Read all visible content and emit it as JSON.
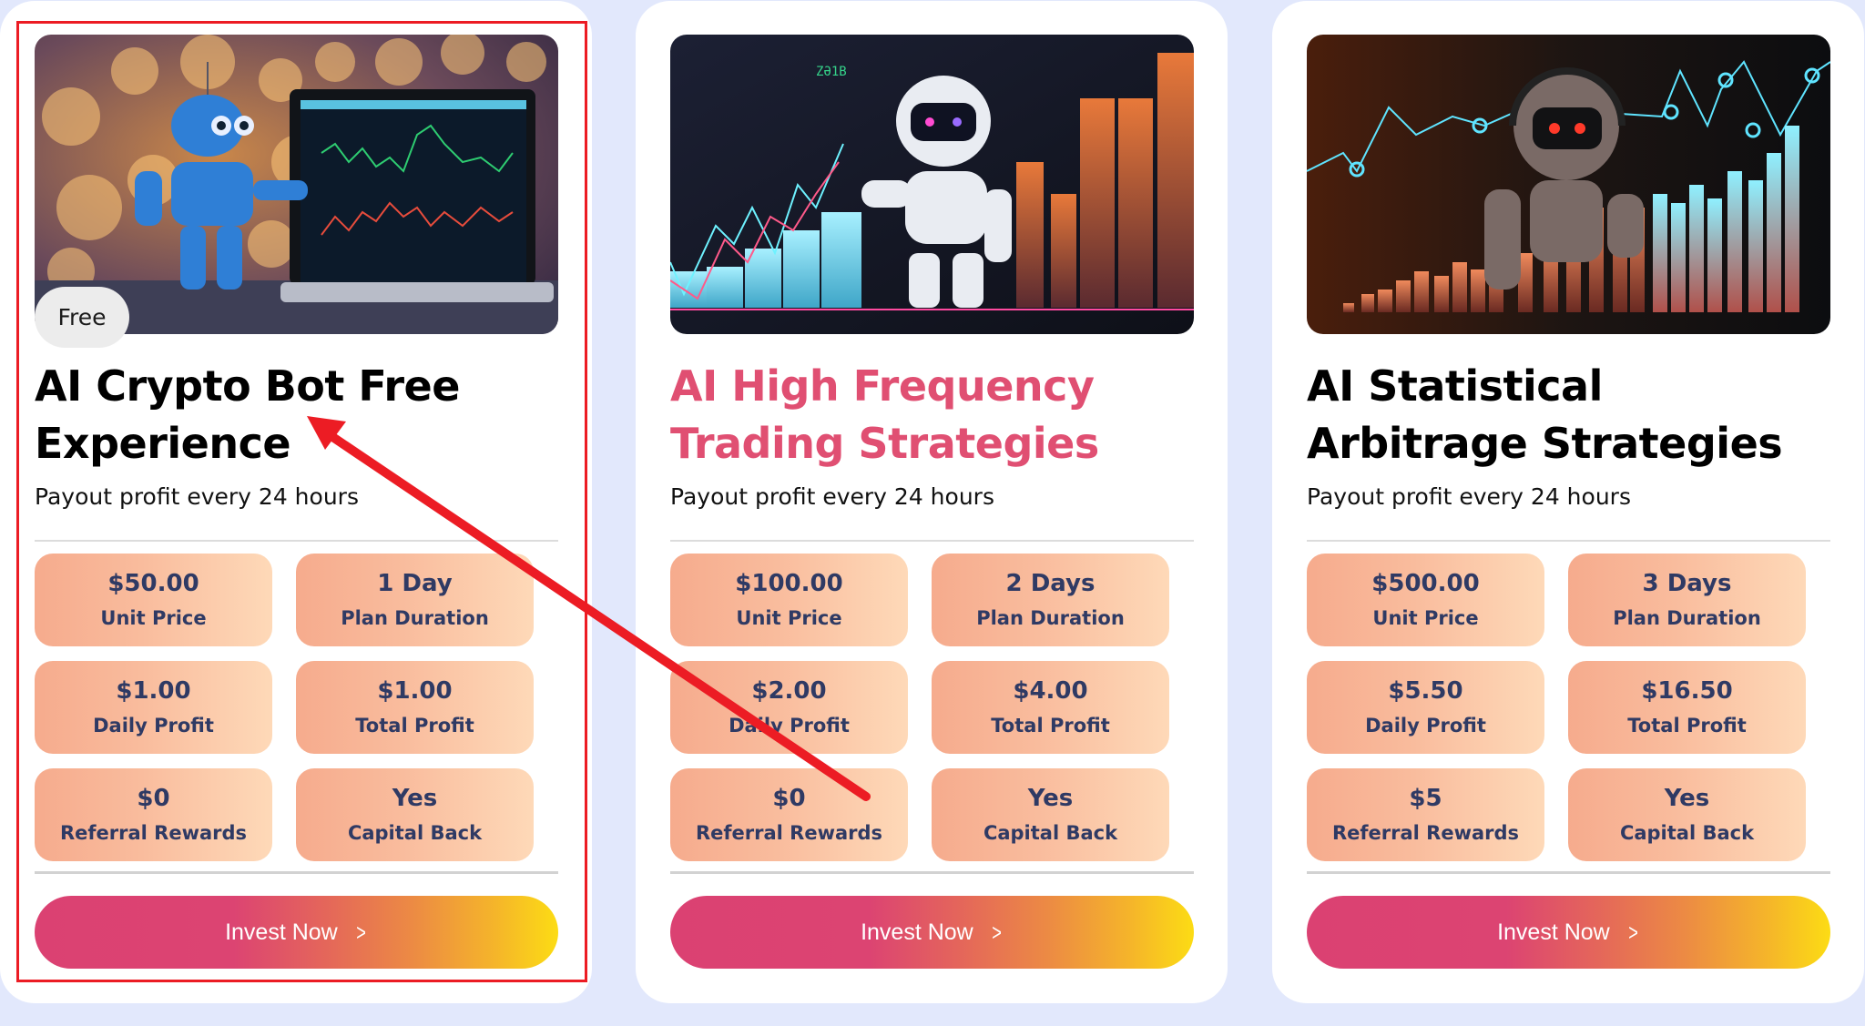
{
  "colors": {
    "page_background": "#e2e8fc",
    "card_background": "#ffffff",
    "highlight_title": "#e04f72",
    "stat_text": "#2f3a64",
    "stat_gradient": [
      "#f6ab8d",
      "#fed9b8"
    ],
    "button_gradient": [
      "#db4172",
      "#ec8a44",
      "#fcdc14"
    ],
    "annotation": "#ec1c24"
  },
  "plans": [
    {
      "image": "robot-with-laptop-trading-chart",
      "badge": "Free",
      "title": "AI Crypto Bot Free Experience",
      "title_highlighted": false,
      "subtitle": "Payout profit every 24 hours",
      "stats": [
        {
          "value": "$50.00",
          "label": "Unit Price"
        },
        {
          "value": "1 Day",
          "label": "Plan Duration"
        },
        {
          "value": "$1.00",
          "label": "Daily Profit"
        },
        {
          "value": "$1.00",
          "label": "Total Profit"
        },
        {
          "value": "$0",
          "label": "Referral Rewards"
        },
        {
          "value": "Yes",
          "label": "Capital Back"
        }
      ],
      "button": {
        "label": "Invest Now",
        "icon": "chevron-right-icon"
      }
    },
    {
      "image": "white-robot-with-bar-chart",
      "badge": null,
      "title": "AI High Frequency Trading Strategies",
      "title_highlighted": true,
      "subtitle": "Payout profit every 24 hours",
      "stats": [
        {
          "value": "$100.00",
          "label": "Unit Price"
        },
        {
          "value": "2 Days",
          "label": "Plan Duration"
        },
        {
          "value": "$2.00",
          "label": "Daily Profit"
        },
        {
          "value": "$4.00",
          "label": "Total Profit"
        },
        {
          "value": "$0",
          "label": "Referral Rewards"
        },
        {
          "value": "Yes",
          "label": "Capital Back"
        }
      ],
      "button": {
        "label": "Invest Now",
        "icon": "chevron-right-icon"
      }
    },
    {
      "image": "metal-robot-with-headphones-bar-chart",
      "badge": null,
      "title": "AI Statistical Arbitrage Strategies",
      "title_highlighted": false,
      "subtitle": "Payout profit every 24 hours",
      "stats": [
        {
          "value": "$500.00",
          "label": "Unit Price"
        },
        {
          "value": "3 Days",
          "label": "Plan Duration"
        },
        {
          "value": "$5.50",
          "label": "Daily Profit"
        },
        {
          "value": "$16.50",
          "label": "Total Profit"
        },
        {
          "value": "$5",
          "label": "Referral Rewards"
        },
        {
          "value": "Yes",
          "label": "Capital Back"
        }
      ],
      "button": {
        "label": "Invest Now",
        "icon": "chevron-right-icon"
      }
    }
  ],
  "annotation": {
    "highlight": "red-rectangle-around-first-plan",
    "arrow": "red-arrow-pointing-to-first-plan-title"
  }
}
